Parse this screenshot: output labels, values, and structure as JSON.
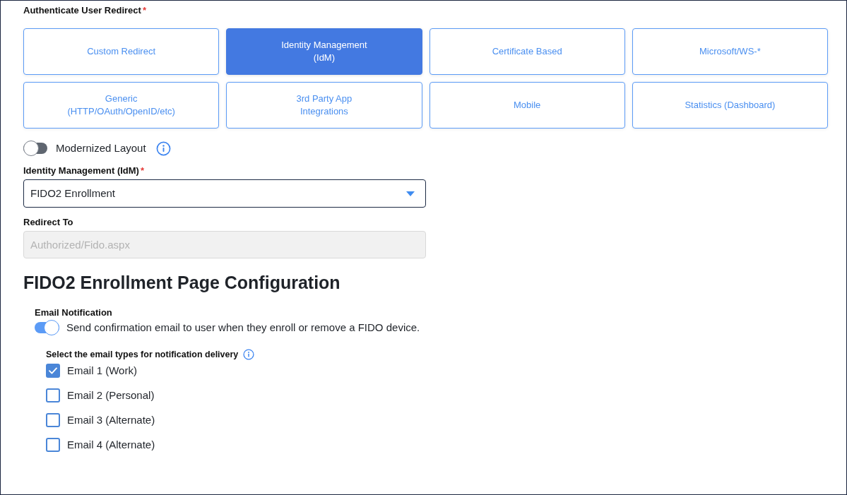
{
  "redirect_field": {
    "label": "Authenticate User Redirect",
    "required_mark": "*"
  },
  "redirect_options": [
    {
      "label": "Custom Redirect",
      "selected": false
    },
    {
      "label": "Identity Management\n(IdM)",
      "selected": true
    },
    {
      "label": "Certificate Based",
      "selected": false
    },
    {
      "label": "Microsoft/WS-*",
      "selected": false
    },
    {
      "label": "Generic\n(HTTP/OAuth/OpenID/etc)",
      "selected": false
    },
    {
      "label": "3rd Party App\nIntegrations",
      "selected": false
    },
    {
      "label": "Mobile",
      "selected": false
    },
    {
      "label": "Statistics (Dashboard)",
      "selected": false
    }
  ],
  "modernized_layout": {
    "label": "Modernized Layout",
    "on": false
  },
  "idm_field": {
    "label": "Identity Management (IdM)",
    "required_mark": "*",
    "value": "FIDO2 Enrollment"
  },
  "redirect_to": {
    "label": "Redirect To",
    "value": "Authorized/Fido.aspx",
    "disabled": true
  },
  "section": {
    "title": "FIDO2 Enrollment Page Configuration",
    "email_notification": {
      "label": "Email Notification",
      "on": true,
      "description": "Send confirmation email to user when they enroll or remove a FIDO device."
    },
    "email_types": {
      "label": "Select the email types for notification delivery",
      "options": [
        {
          "label": "Email 1 (Work)",
          "checked": true
        },
        {
          "label": "Email 2 (Personal)",
          "checked": false
        },
        {
          "label": "Email 3 (Alternate)",
          "checked": false
        },
        {
          "label": "Email 4 (Alternate)",
          "checked": false
        }
      ]
    }
  }
}
